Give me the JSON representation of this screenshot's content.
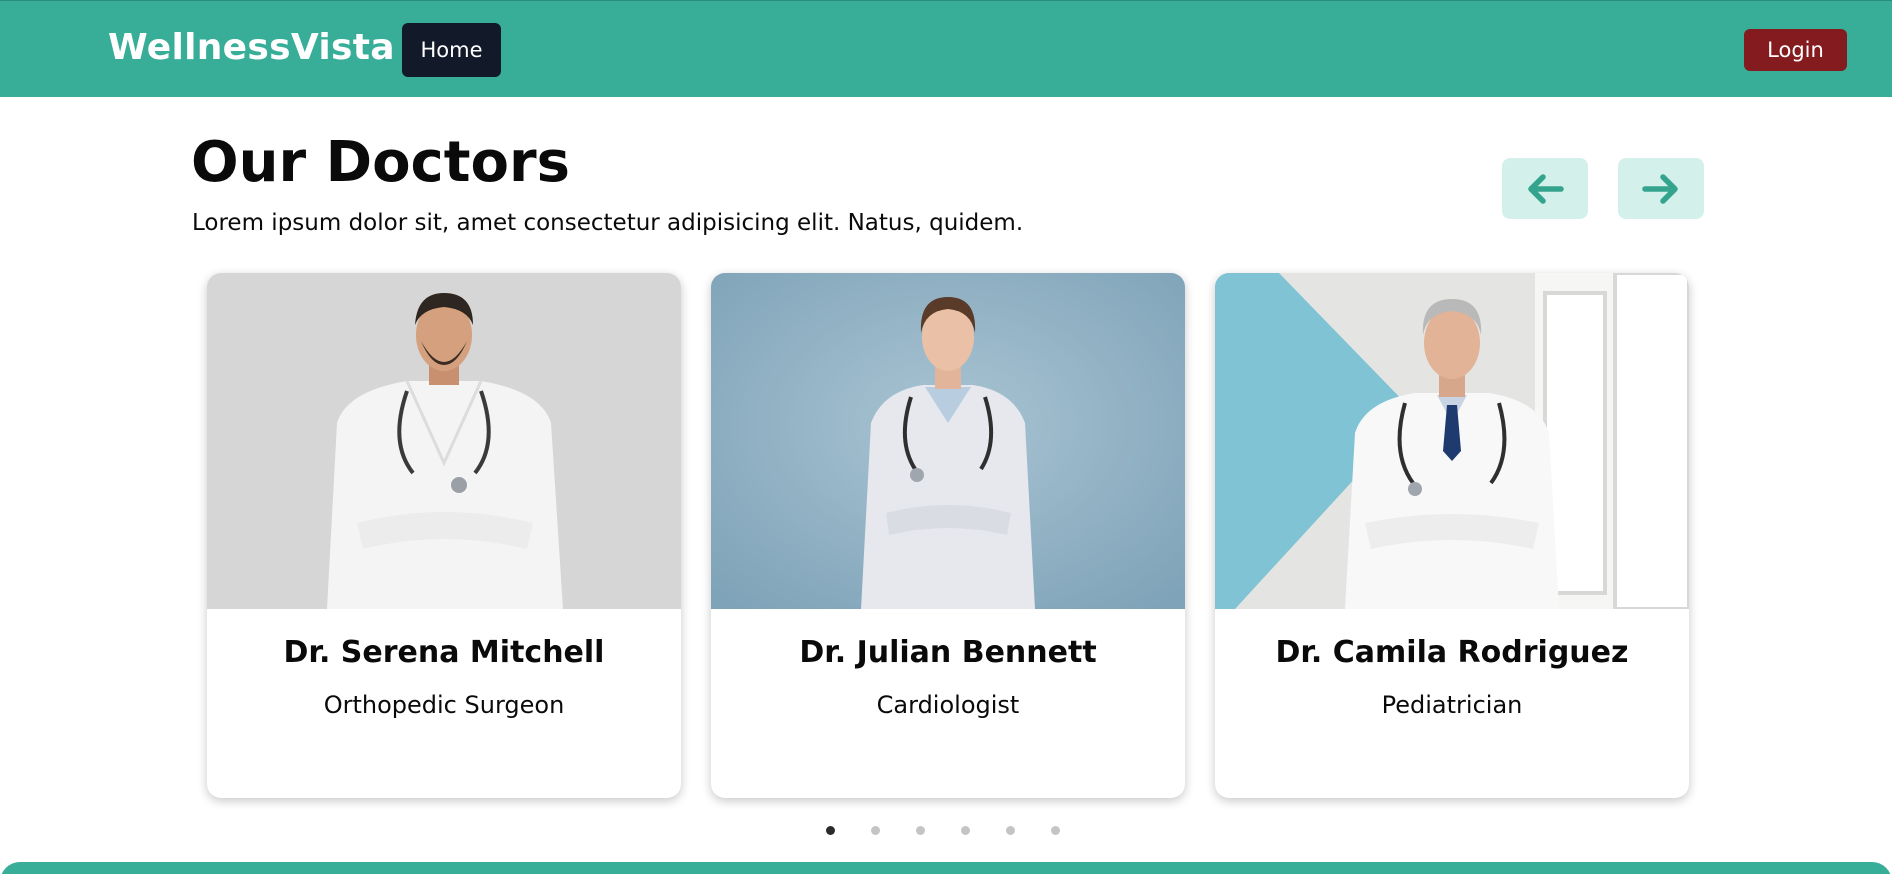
{
  "navbar": {
    "brand": "WellnessVista",
    "home_label": "Home",
    "login_label": "Login"
  },
  "section": {
    "title": "Our Doctors",
    "subtitle": "Lorem ipsum dolor sit, amet consectetur adipisicing elit. Natus, quidem.",
    "prev_icon": "arrow-left-icon",
    "next_icon": "arrow-right-icon"
  },
  "doctors": [
    {
      "name": "Dr. Serena Mitchell",
      "role": "Orthopedic Surgeon"
    },
    {
      "name": "Dr. Julian Bennett",
      "role": "Cardiologist"
    },
    {
      "name": "Dr. Camila Rodriguez",
      "role": "Pediatrician"
    }
  ],
  "carousel": {
    "dot_count": 6,
    "active_index": 0
  },
  "colors": {
    "primary_teal": "#38ae99",
    "nav_dark": "#121a2a",
    "login_red": "#841b1f",
    "arrow_bg": "#d3f1ea"
  }
}
